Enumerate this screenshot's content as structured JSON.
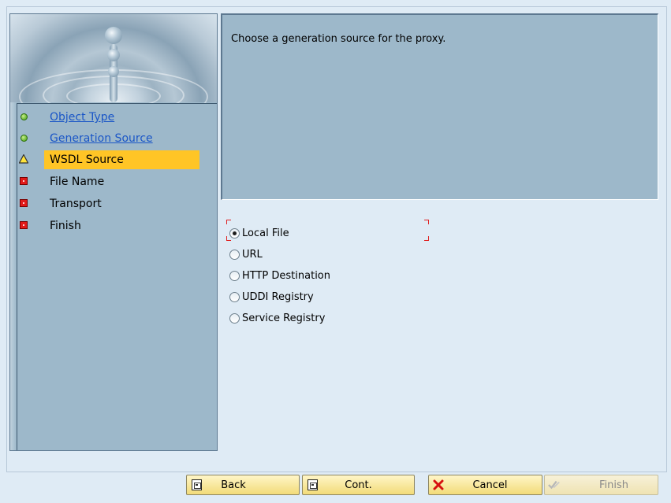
{
  "description": "Choose a generation source for the proxy.",
  "steps": [
    {
      "label": "Object Type",
      "status": "done",
      "icon": "green-status-icon",
      "link": true
    },
    {
      "label": "Generation Source",
      "status": "done",
      "icon": "green-status-icon",
      "link": true
    },
    {
      "label": "WSDL Source",
      "status": "current",
      "icon": "warning-icon",
      "link": false
    },
    {
      "label": "File Name",
      "status": "pending",
      "icon": "red-status-icon",
      "link": false
    },
    {
      "label": "Transport",
      "status": "pending",
      "icon": "red-status-icon",
      "link": false
    },
    {
      "label": "Finish",
      "status": "pending",
      "icon": "red-status-icon",
      "link": false
    }
  ],
  "options": [
    {
      "label": "Local File",
      "checked": true
    },
    {
      "label": "URL",
      "checked": false
    },
    {
      "label": "HTTP Destination",
      "checked": false
    },
    {
      "label": "UDDI Registry",
      "checked": false
    },
    {
      "label": "Service Registry",
      "checked": false
    }
  ],
  "buttons": {
    "back": "Back",
    "cont": "Cont.",
    "cancel": "Cancel",
    "finish": "Finish"
  },
  "colors": {
    "panel": "#9db8ca",
    "active_step": "#ffc526",
    "link": "#1a56c7",
    "button": "#f2db78"
  }
}
